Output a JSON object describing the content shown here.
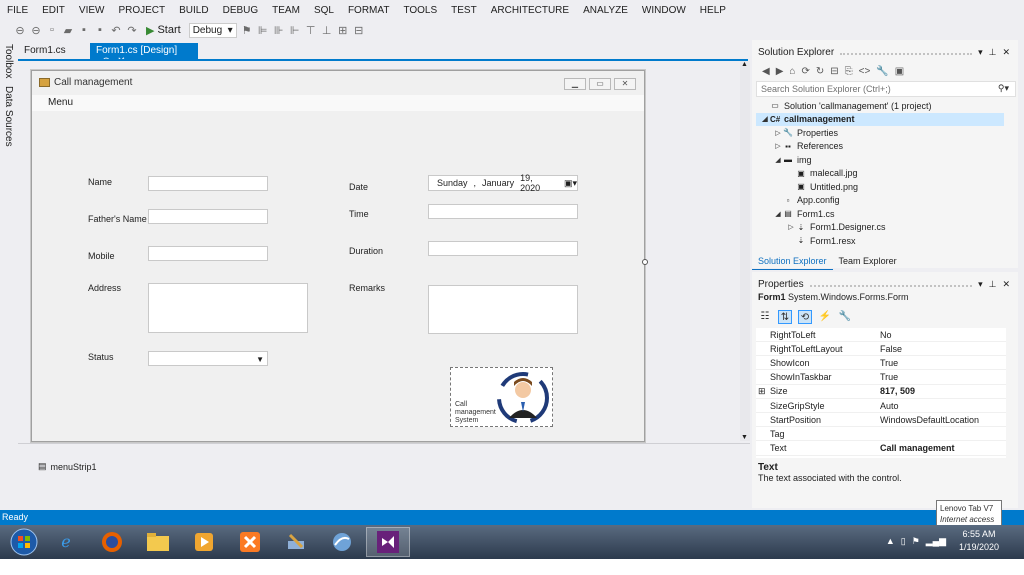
{
  "menu": [
    "FILE",
    "EDIT",
    "VIEW",
    "PROJECT",
    "BUILD",
    "DEBUG",
    "TEAM",
    "SQL",
    "FORMAT",
    "TOOLS",
    "TEST",
    "ARCHITECTURE",
    "ANALYZE",
    "WINDOW",
    "HELP"
  ],
  "toolbar": {
    "start_label": "Start",
    "config_value": "Debug"
  },
  "left_rail": {
    "toolbox": "Toolbox",
    "data_sources": "Data Sources"
  },
  "doc_tabs": {
    "tab1": "Form1.cs",
    "tab2": "Form1.cs [Design]",
    "pin": "⊕",
    "close": "✕"
  },
  "form": {
    "title": "Call management",
    "menu_label": "Menu",
    "labels": {
      "name": "Name",
      "father": "Father's Name",
      "mobile": "Mobile",
      "address": "Address",
      "status": "Status",
      "date": "Date",
      "time": "Time",
      "duration": "Duration",
      "remarks": "Remarks"
    },
    "date_picker": {
      "day": "Sunday",
      "sep": ",",
      "month": "January",
      "date": "19, 2020"
    },
    "picture_text": [
      "Call",
      "management",
      "System"
    ]
  },
  "tray": {
    "component": "menuStrip1"
  },
  "solution_explorer": {
    "title": "Solution Explorer",
    "search_placeholder": "Search Solution Explorer (Ctrl+;)",
    "tree": [
      {
        "label": "Solution 'callmanagement' (1 project)",
        "level": 0,
        "expander": "",
        "icon": "▭"
      },
      {
        "label": "callmanagement",
        "level": 0,
        "expander": "◢",
        "icon": "C#",
        "selected": true
      },
      {
        "label": "Properties",
        "level": 1,
        "expander": "▷",
        "icon": "🔧"
      },
      {
        "label": "References",
        "level": 1,
        "expander": "▷",
        "icon": "▪▪"
      },
      {
        "label": "img",
        "level": 1,
        "expander": "◢",
        "icon": "▬"
      },
      {
        "label": "malecall.jpg",
        "level": 2,
        "expander": "",
        "icon": "▣"
      },
      {
        "label": "Untitled.png",
        "level": 2,
        "expander": "",
        "icon": "▣"
      },
      {
        "label": "App.config",
        "level": 1,
        "expander": "",
        "icon": "▫"
      },
      {
        "label": "Form1.cs",
        "level": 1,
        "expander": "◢",
        "icon": "▤"
      },
      {
        "label": "Form1.Designer.cs",
        "level": 2,
        "expander": "▷",
        "icon": "⇣"
      },
      {
        "label": "Form1.resx",
        "level": 2,
        "expander": "",
        "icon": "⇣"
      }
    ],
    "tabs": [
      "Solution Explorer",
      "Team Explorer"
    ]
  },
  "properties": {
    "title": "Properties",
    "object": "Form1",
    "object_type": "System.Windows.Forms.Form",
    "rows": [
      {
        "name": "RightToLeft",
        "value": "No"
      },
      {
        "name": "RightToLeftLayout",
        "value": "False"
      },
      {
        "name": "ShowIcon",
        "value": "True"
      },
      {
        "name": "ShowInTaskbar",
        "value": "True"
      },
      {
        "name": "Size",
        "value": "817, 509",
        "bold": true,
        "expander": "⊞"
      },
      {
        "name": "SizeGripStyle",
        "value": "Auto"
      },
      {
        "name": "StartPosition",
        "value": "WindowsDefaultLocation"
      },
      {
        "name": "Tag",
        "value": ""
      },
      {
        "name": "Text",
        "value": "Call management",
        "bold": true
      }
    ],
    "desc_title": "Text",
    "desc_text": "The text associated with the control."
  },
  "status": {
    "text": "Ready"
  },
  "tooltip": {
    "line1": "Lenovo Tab V7",
    "line2": "Internet access"
  },
  "taskbar": {
    "time": "6:55 AM",
    "date": "1/19/2020"
  },
  "colors": {
    "accent": "#007acc",
    "selection": "#cce8ff"
  }
}
